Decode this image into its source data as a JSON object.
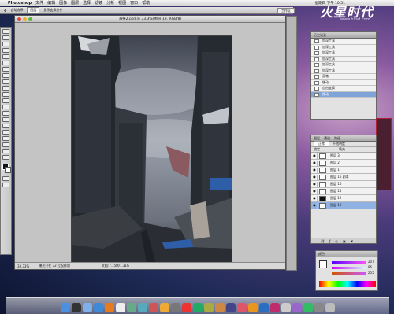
{
  "menubar": {
    "app": "Photoshop",
    "items": [
      "文件",
      "编辑",
      "图像",
      "图层",
      "选择",
      "滤镜",
      "分析",
      "视图",
      "窗口",
      "帮助"
    ],
    "clock": "星期四 下午 10:51"
  },
  "options": {
    "auto_select": "自动选择",
    "layer_dropdown": "图层",
    "show_transform": "显示变换控件",
    "workspace": "工作区"
  },
  "document": {
    "title": "海报2.psd @ 33.3%(图层 19, RGB/8)",
    "zoom": "33.33%",
    "doc_info": "曝光只在 32 位起作用",
    "bottom_info": "文档:7.15M/1.31G"
  },
  "logo": {
    "text": "火星时代",
    "url": "www.hxsd.com"
  },
  "history": {
    "title": "历史记录",
    "items": [
      "加深工具",
      "加深工具",
      "加深工具",
      "加深工具",
      "加深工具",
      "加深工具",
      "画笔",
      "移动",
      "自由变换",
      "移动"
    ],
    "selected_index": 9
  },
  "layers": {
    "tabs": [
      "图层",
      "通道",
      "路径"
    ],
    "blend": "正常",
    "opacity_label": "不透明度",
    "lock_label": "锁定",
    "fill_label": "填充",
    "items": [
      "图层 3",
      "图层 2",
      "图层 1",
      "图层 16 副本",
      "图层 16",
      "图层 15",
      "图层 12",
      "图层 19"
    ],
    "selected_index": 7
  },
  "color": {
    "title": "颜色",
    "r": "207",
    "g": "86",
    "b": "255"
  },
  "colors": {
    "sky_top": "#3e4350",
    "sky_mid": "#9aa0ab",
    "ground": "#2a2d33",
    "accent_blue": "#2f5ea8"
  }
}
